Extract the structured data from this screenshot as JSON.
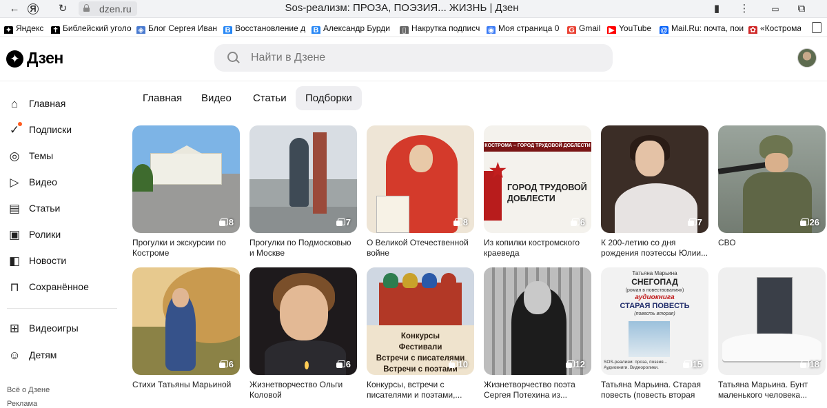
{
  "browser": {
    "url": "dzen.ru",
    "page_title": "Sos-реализм: ПРОЗА, ПОЭЗИЯ... ЖИЗНЬ | Дзен",
    "bookmarks": [
      {
        "label": "Яндекс",
        "icon": "yandex-icon",
        "color": "#000000"
      },
      {
        "label": "Библейский уголо",
        "icon": "book-icon",
        "color": "#000000"
      },
      {
        "label": "Блог Сергея Иван",
        "icon": "blog-icon",
        "color": "#4a7bd0"
      },
      {
        "label": "Восстановление д",
        "icon": "vk-icon",
        "color": "#2787f5"
      },
      {
        "label": "Александр Бурди",
        "icon": "vk-icon",
        "color": "#2787f5"
      },
      {
        "label": "Накрутка подписч",
        "icon": "page-icon",
        "color": "#666666"
      },
      {
        "label": "Моя страница 0",
        "icon": "chat-icon",
        "color": "#3b7bf5"
      },
      {
        "label": "Gmail",
        "icon": "google-icon",
        "color": "#ea4335"
      },
      {
        "label": "YouTube",
        "icon": "youtube-icon",
        "color": "#ff0000"
      },
      {
        "label": "Mail.Ru: почта, пои",
        "icon": "mailru-icon",
        "color": "#005ff9"
      },
      {
        "label": "«Кострома",
        "icon": "flower-icon",
        "color": "#d02a2a"
      }
    ]
  },
  "header": {
    "logo_text": "Дзен",
    "search_placeholder": "Найти в Дзене"
  },
  "sidebar": {
    "items": [
      {
        "label": "Главная",
        "icon": "home-icon"
      },
      {
        "label": "Подписки",
        "icon": "subscriptions-icon",
        "badge": true
      },
      {
        "label": "Темы",
        "icon": "compass-icon"
      },
      {
        "label": "Видео",
        "icon": "video-icon"
      },
      {
        "label": "Статьи",
        "icon": "articles-icon"
      },
      {
        "label": "Ролики",
        "icon": "shorts-icon"
      },
      {
        "label": "Новости",
        "icon": "news-icon"
      },
      {
        "label": "Сохранённое",
        "icon": "bookmark-icon"
      }
    ],
    "extra": [
      {
        "label": "Видеоигры",
        "icon": "gamepad-icon"
      },
      {
        "label": "Детям",
        "icon": "kids-icon"
      }
    ],
    "footer": [
      "Всё о Дзене",
      "Реклама"
    ]
  },
  "tabs": [
    {
      "label": "Главная",
      "active": false
    },
    {
      "label": "Видео",
      "active": false
    },
    {
      "label": "Статьи",
      "active": false
    },
    {
      "label": "Подборки",
      "active": true
    }
  ],
  "collections": [
    {
      "title": "Прогулки и экскурсии по Костроме",
      "count": "8"
    },
    {
      "title": "Прогулки по Подмосковью и Москве",
      "count": "7"
    },
    {
      "title": "О Великой Отечественной войне",
      "count": "8"
    },
    {
      "title": "Из копилки костромского краеведа",
      "count": "6"
    },
    {
      "title": "К 200-летию со дня рождения поэтессы Юлии...",
      "count": "7"
    },
    {
      "title": "СВО",
      "count": "26"
    },
    {
      "title": "Стихи Татьяны Марьиной",
      "count": "6"
    },
    {
      "title": "Жизнетворчество Ольги Коловой",
      "count": "6"
    },
    {
      "title": "Конкурсы, встречи с писателями и поэтами,...",
      "count": "10"
    },
    {
      "title": "Жизнетворчество поэта Сергея Потехина из...",
      "count": "12"
    },
    {
      "title": "Татьяна Марьина. Старая повесть (повесть вторая из...",
      "count": "15"
    },
    {
      "title": "Татьяна Марьина. Бунт маленького человека...",
      "count": "18"
    }
  ],
  "thumb_text": {
    "kostroma_band": "КОСТРОМА – ГОРОД ТРУДОВОЙ ДОБЛЕСТИ",
    "kostroma_big": "ГОРОД ТРУДОВОЙ ДОБЛЕСТИ",
    "contest_lines": [
      "Конкурсы",
      "Фестивали",
      "Встречи с писателями",
      "Встречи с поэтами"
    ],
    "book_author": "Татьяна Марьина",
    "book_title1": "СНЕГОПАД",
    "book_sub1": "(роман в повествованиях)",
    "book_kind": "аудиокнига",
    "book_title2": "СТАРАЯ ПОВЕСТЬ",
    "book_sub2": "(повесть вторая)",
    "book_foot": "SOS-реализм: проза, поэзия... Аудиокниги. Видеоролики."
  }
}
